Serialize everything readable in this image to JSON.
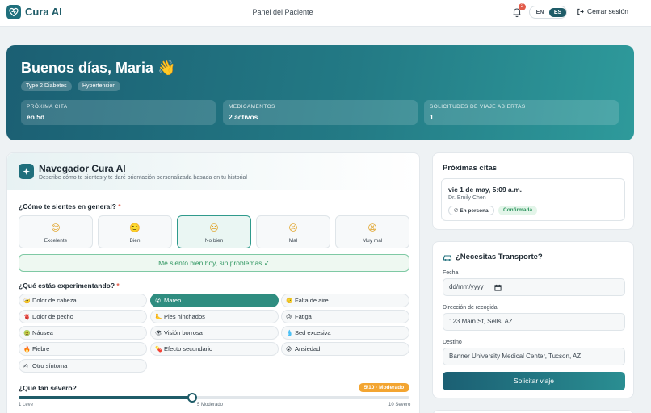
{
  "header": {
    "brand": "Cura AI",
    "page_title": "Panel del Paciente",
    "notification_count": "2",
    "lang_en": "EN",
    "lang_es": "ES",
    "logout": "Cerrar sesión"
  },
  "hero": {
    "greeting": "Buenos días, Maria 👋",
    "tags": [
      "Type 2 Diabetes",
      "Hypertension"
    ],
    "stats": [
      {
        "label": "PRÓXIMA CITA",
        "value": "en 5d"
      },
      {
        "label": "MEDICAMENTOS",
        "value": "2 activos"
      },
      {
        "label": "SOLICITUDES DE VIAJE ABIERTAS",
        "value": "1"
      }
    ]
  },
  "navigator": {
    "title": "Navegador Cura AI",
    "subtitle": "Describe cómo te sientes y te daré orientación personalizada basada en tu historial",
    "feel_question": "¿Cómo te sientes en general?",
    "required_mark": "*",
    "feelings": [
      {
        "emoji": "😊",
        "label": "Excelente"
      },
      {
        "emoji": "🙂",
        "label": "Bien"
      },
      {
        "emoji": "😐",
        "label": "No bien"
      },
      {
        "emoji": "😣",
        "label": "Mal"
      },
      {
        "emoji": "😫",
        "label": "Muy mal"
      }
    ],
    "ok_button": "Me siento bien hoy, sin problemas ✓",
    "symptom_question": "¿Qué estás experimentando?",
    "symptoms": [
      {
        "emoji": "🤕",
        "label": "Dolor de cabeza"
      },
      {
        "emoji": "😵",
        "label": "Mareo"
      },
      {
        "emoji": "😮‍💨",
        "label": "Falta de aire"
      },
      {
        "emoji": "🫀",
        "label": "Dolor de pecho"
      },
      {
        "emoji": "🦶",
        "label": "Pies hinchados"
      },
      {
        "emoji": "😓",
        "label": "Fatiga"
      },
      {
        "emoji": "🤢",
        "label": "Náusea"
      },
      {
        "emoji": "👁",
        "label": "Visión borrosa"
      },
      {
        "emoji": "💧",
        "label": "Sed excesiva"
      },
      {
        "emoji": "🔥",
        "label": "Fiebre"
      },
      {
        "emoji": "💊",
        "label": "Efecto secundario"
      },
      {
        "emoji": "😰",
        "label": "Ansiedad"
      },
      {
        "emoji": "✍",
        "label": "Otro síntoma"
      }
    ],
    "severity_question": "¿Qué tan severo?",
    "severity_badge": "5/10 · Moderado",
    "severity_value": 5,
    "severity_min": 1,
    "severity_max": 10,
    "severity_ticks": [
      "1 Leve",
      "5 Moderado",
      "10 Severo"
    ]
  },
  "appointments": {
    "title": "Próximas citas",
    "date": "vie 1 de may, 5:09 a.m.",
    "doctor": "Dr. Emily Chen",
    "mode": "En persona",
    "status": "Confirmada"
  },
  "transport": {
    "title": "¿Necesitas Transporte?",
    "date_label": "Fecha",
    "date_value": "dd/mm/yyyy",
    "pickup_label": "Dirección de recogida",
    "pickup_value": "123 Main St, Sells, AZ",
    "dest_label": "Destino",
    "dest_value": "Banner University Medical Center, Tucson, AZ",
    "button": "Solicitar viaje"
  },
  "colors": {
    "brand": "#1f5c68",
    "accent": "#2f8d80",
    "warning": "#f3a531",
    "success": "#2f9660"
  }
}
